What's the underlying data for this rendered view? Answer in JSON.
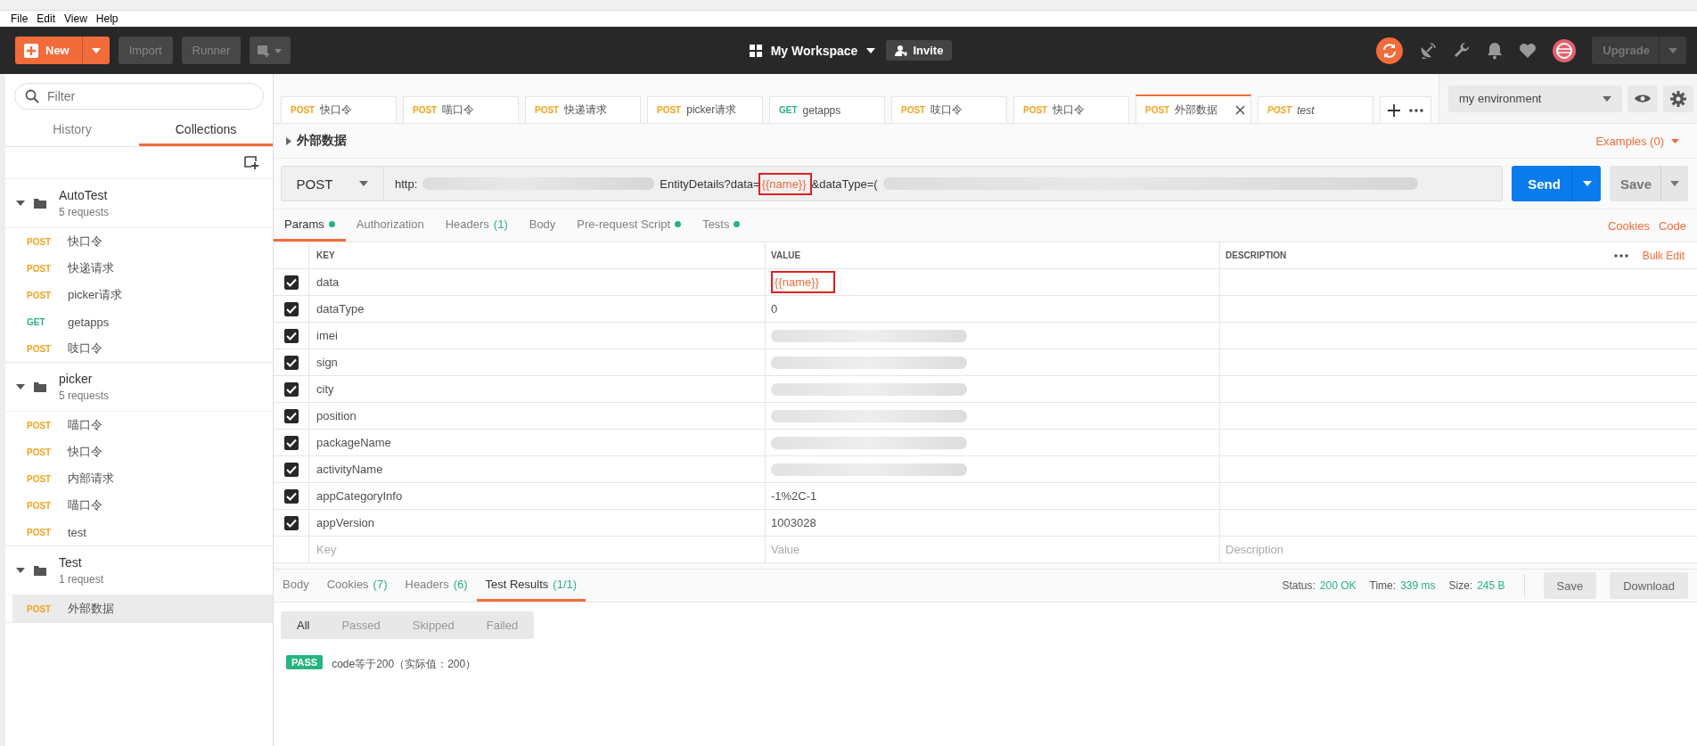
{
  "menu": [
    "File",
    "Edit",
    "View",
    "Help"
  ],
  "header": {
    "new": "New",
    "import": "Import",
    "runner": "Runner",
    "workspace": "My Workspace",
    "invite": "Invite",
    "upgrade": "Upgrade"
  },
  "sidebar": {
    "search": {
      "placeholder": "Filter"
    },
    "tabs": [
      {
        "label": "History",
        "selected": false
      },
      {
        "label": "Collections",
        "selected": true
      }
    ],
    "collections": [
      {
        "name": "AutoTest",
        "count": "5 requests",
        "expanded": true,
        "requests": [
          {
            "method": "POST",
            "name": "快口令",
            "selected": false
          },
          {
            "method": "POST",
            "name": "快递请求",
            "selected": false
          },
          {
            "method": "POST",
            "name": "picker请求",
            "selected": false
          },
          {
            "method": "GET",
            "name": "getapps",
            "selected": false
          },
          {
            "method": "POST",
            "name": "吱口令",
            "selected": false
          }
        ]
      },
      {
        "name": "picker",
        "count": "5 requests",
        "expanded": true,
        "requests": [
          {
            "method": "POST",
            "name": "喵口令",
            "selected": false
          },
          {
            "method": "POST",
            "name": "快口令",
            "selected": false
          },
          {
            "method": "POST",
            "name": "内部请求",
            "selected": false
          },
          {
            "method": "POST",
            "name": "喵口令",
            "selected": false
          },
          {
            "method": "POST",
            "name": "test",
            "selected": false
          }
        ]
      },
      {
        "name": "Test",
        "count": "1 request",
        "expanded": true,
        "requests": [
          {
            "method": "POST",
            "name": "外部数据",
            "selected": true
          }
        ]
      }
    ]
  },
  "request_tabs": [
    {
      "method": "POST",
      "name": "快口令",
      "selected": false,
      "unsaved": false
    },
    {
      "method": "POST",
      "name": "喵口令",
      "selected": false,
      "unsaved": false
    },
    {
      "method": "POST",
      "name": "快递请求",
      "selected": false,
      "unsaved": false
    },
    {
      "method": "POST",
      "name": "picker请求",
      "selected": false,
      "unsaved": false
    },
    {
      "method": "GET",
      "name": "getapps",
      "selected": false,
      "unsaved": false
    },
    {
      "method": "POST",
      "name": "吱口令",
      "selected": false,
      "unsaved": false
    },
    {
      "method": "POST",
      "name": "快口令",
      "selected": false,
      "unsaved": false
    },
    {
      "method": "POST",
      "name": "外部数据",
      "selected": true,
      "unsaved": false
    },
    {
      "method": "POST",
      "name": "test",
      "selected": false,
      "unsaved": true
    }
  ],
  "environment": {
    "value": "my environment"
  },
  "request": {
    "name": "外部数据",
    "examples": "Examples (0)",
    "method": "POST",
    "send": "Send",
    "save": "Save",
    "url": [
      {
        "kind": "text",
        "text": "http:"
      },
      {
        "kind": "redacted"
      },
      {
        "kind": "text",
        "text": "EntityDetails?data="
      },
      {
        "kind": "variable",
        "text": "{{name}}",
        "highlighted": true
      },
      {
        "kind": "text",
        "text": "&dataType=("
      },
      {
        "kind": "redacted"
      }
    ]
  },
  "param_tabs": [
    {
      "label": "Params",
      "selected": true,
      "dot": true
    },
    {
      "label": "Authorization",
      "selected": false,
      "dot": false
    },
    {
      "label": "Headers",
      "count": "(1)",
      "selected": false,
      "dot": false
    },
    {
      "label": "Body",
      "selected": false,
      "dot": false
    },
    {
      "label": "Pre-request Script",
      "selected": false,
      "dot": true
    },
    {
      "label": "Tests",
      "selected": false,
      "dot": true
    }
  ],
  "links": [
    "Cookies",
    "Code"
  ],
  "params": {
    "columns": [
      "KEY",
      "VALUE",
      "DESCRIPTION"
    ],
    "bulk_edit": "Bulk Edit",
    "rows": [
      {
        "checked": true,
        "key": "data",
        "value": "{{name}}",
        "kind": "variable",
        "highlighted": true
      },
      {
        "checked": true,
        "key": "dataType",
        "value": "0",
        "kind": "text"
      },
      {
        "checked": true,
        "key": "imei",
        "kind": "redacted"
      },
      {
        "checked": true,
        "key": "sign",
        "kind": "redacted"
      },
      {
        "checked": true,
        "key": "city",
        "kind": "redacted"
      },
      {
        "checked": true,
        "key": "position",
        "kind": "redacted"
      },
      {
        "checked": true,
        "key": "packageName",
        "kind": "redacted"
      },
      {
        "checked": true,
        "key": "activityName",
        "kind": "redacted"
      },
      {
        "checked": true,
        "key": "appCategoryInfo",
        "value": "-1%2C-1",
        "kind": "text"
      },
      {
        "checked": true,
        "key": "appVersion",
        "value": "1003028",
        "kind": "text"
      }
    ],
    "new_row": {
      "key": {
        "placeholder": "Key"
      },
      "value": {
        "placeholder": "Value"
      },
      "description": {
        "placeholder": "Description"
      }
    }
  },
  "response": {
    "tabs": [
      {
        "label": "Body",
        "selected": false
      },
      {
        "label": "Cookies",
        "count": "(7)",
        "selected": false
      },
      {
        "label": "Headers",
        "count": "(6)",
        "selected": false
      },
      {
        "label": "Test Results",
        "count": "(1/1)",
        "selected": true
      }
    ],
    "stats": [
      {
        "label": "Status:",
        "value": "200 OK"
      },
      {
        "label": "Time:",
        "value": "339 ms"
      },
      {
        "label": "Size:",
        "value": "245 B"
      }
    ],
    "buttons": [
      "Save",
      "Download"
    ],
    "filters": [
      {
        "label": "All",
        "selected": true
      },
      {
        "label": "Passed",
        "selected": false
      },
      {
        "label": "Skipped",
        "selected": false
      },
      {
        "label": "Failed",
        "selected": false
      }
    ],
    "results": [
      {
        "badge": "PASS",
        "text": "code等于200（实际值：200）"
      }
    ]
  }
}
